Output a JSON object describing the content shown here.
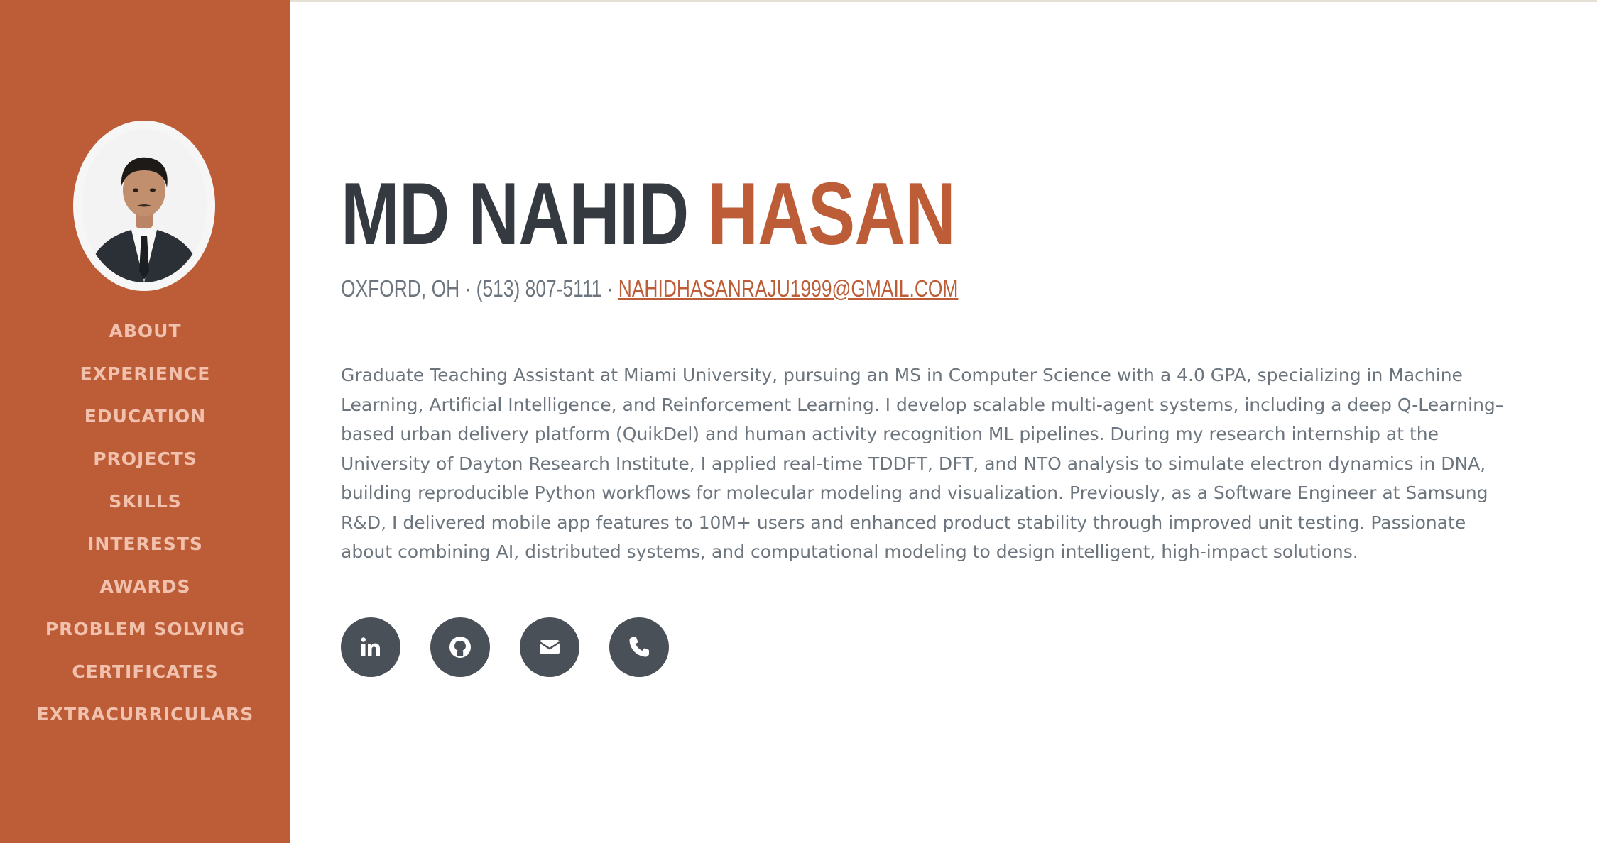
{
  "sidebar": {
    "avatar_alt": "profile photo",
    "nav": [
      {
        "label": "ABOUT"
      },
      {
        "label": "EXPERIENCE"
      },
      {
        "label": "EDUCATION"
      },
      {
        "label": "PROJECTS"
      },
      {
        "label": "SKILLS"
      },
      {
        "label": "INTERESTS"
      },
      {
        "label": "AWARDS"
      },
      {
        "label": "PROBLEM SOLVING"
      },
      {
        "label": "CERTIFICATES"
      },
      {
        "label": "EXTRACURRICULARS"
      }
    ]
  },
  "header": {
    "first_name": "MD NAHID",
    "last_name": "HASAN",
    "location": "OXFORD, OH",
    "separator": " · ",
    "phone": "(513) 807-5111",
    "email": "NAHIDHASANRAJU1999@GMAIL.COM"
  },
  "about": {
    "bio": "Graduate Teaching Assistant at Miami University, pursuing an MS in Computer Science with a 4.0 GPA, specializing in Machine Learning, Artificial Intelligence, and Reinforcement Learning. I develop scalable multi-agent systems, including a deep Q-Learning–based urban delivery platform (QuikDel) and human activity recognition ML pipelines. During my research internship at the University of Dayton Research Institute, I applied real-time TDDFT, DFT, and NTO analysis to simulate electron dynamics in DNA, building reproducible Python workflows for molecular modeling and visualization. Previously, as a Software Engineer at Samsung R&D, I delivered mobile app features to 10M+ users and enhanced product stability through improved unit testing. Passionate about combining AI, distributed systems, and computational modeling to design intelligent, high-impact solutions."
  },
  "social": [
    {
      "icon": "linkedin-icon"
    },
    {
      "icon": "github-icon"
    },
    {
      "icon": "email-icon"
    },
    {
      "icon": "phone-icon"
    }
  ],
  "colors": {
    "accent": "#bd5d38",
    "heading": "#343a40",
    "text": "#6c757d",
    "nav_text": "#f2c1ad",
    "social_bg": "#495057"
  }
}
